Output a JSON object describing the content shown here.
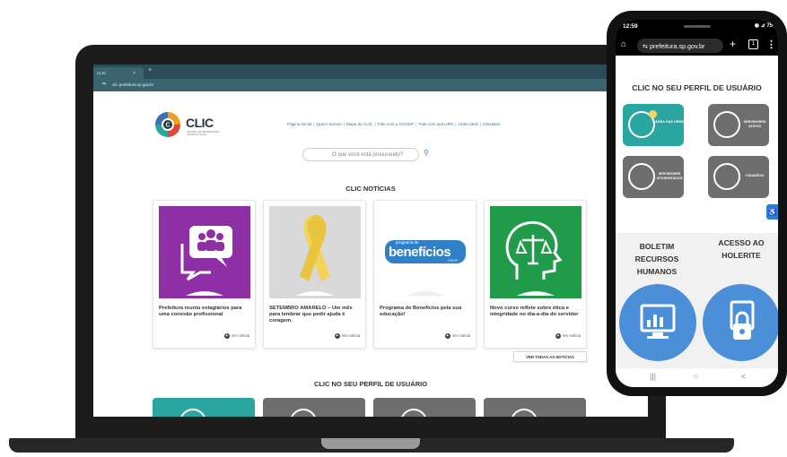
{
  "laptop": {
    "browser": {
      "tab_title": "CLIC",
      "tab_close": "×",
      "new_tab": "+",
      "url": "clic.prefeitura.sp.gov.br"
    },
    "logo_text": "CLIC",
    "logo_subtitle": "CENTRAL DE INFORMAÇÕES ATENDA AO ELOG",
    "nav": [
      "Página Inicial",
      "Quem Somos",
      "Mapa do CLIC",
      "Fale com a COGEP",
      "Fale com sua URH",
      "Links Úteis",
      "Glossário"
    ],
    "nav_separator": "|",
    "search_placeholder": "O que você está procurando?",
    "news_section_title": "CLIC NOTÍCIAS",
    "news": [
      {
        "title": "Prefeitura reuniu estagiários para uma conexão profissional",
        "more": "Ver notícia"
      },
      {
        "title": "SETEMBRO AMARELO – Um mês para lembrar que pedir ajuda é coragem.",
        "more": "Ver notícia"
      },
      {
        "title": "Programa de Benefícios pela sua educação!",
        "more": "Ver notícia"
      },
      {
        "title": "Novo curso reflete sobre ética e integridade no dia-a-dia do servidor",
        "more": "Ver notícia"
      }
    ],
    "beneficios_logo": {
      "small": "programa de",
      "big": "benefícios",
      "tag": "PMSP"
    },
    "see_all_news": "VER TODAS AS NOTÍCIAS",
    "profile_section_title": "CLIC NO SEU PERFIL DE USUÁRIO",
    "colors": {
      "teal": "#2aa6a1",
      "gray": "#6e6e6e",
      "purple": "#8f2fa6",
      "green": "#1f9b49",
      "yellow": "#f3d35b"
    }
  },
  "phone": {
    "status_time": "12:59",
    "status_right": "◉ ⊿ 75",
    "url": "prefeitura.sp.gov.br",
    "tabs_count": "1",
    "title": "CLIC NO SEU PERFIL DE USUÁRIO",
    "tiles": [
      {
        "label": "ÁREA DAS URHS"
      },
      {
        "label": "SERVIDORES ATIVOS"
      },
      {
        "label": "SERVIDORES APOSENTADOS"
      },
      {
        "label": "CIDADÃOS"
      }
    ],
    "boletim": "BOLETIM RECURSOS HUMANOS",
    "holerite": "ACESSO AO HOLERITE",
    "nav_icons": [
      "|||",
      "○",
      "<"
    ]
  }
}
